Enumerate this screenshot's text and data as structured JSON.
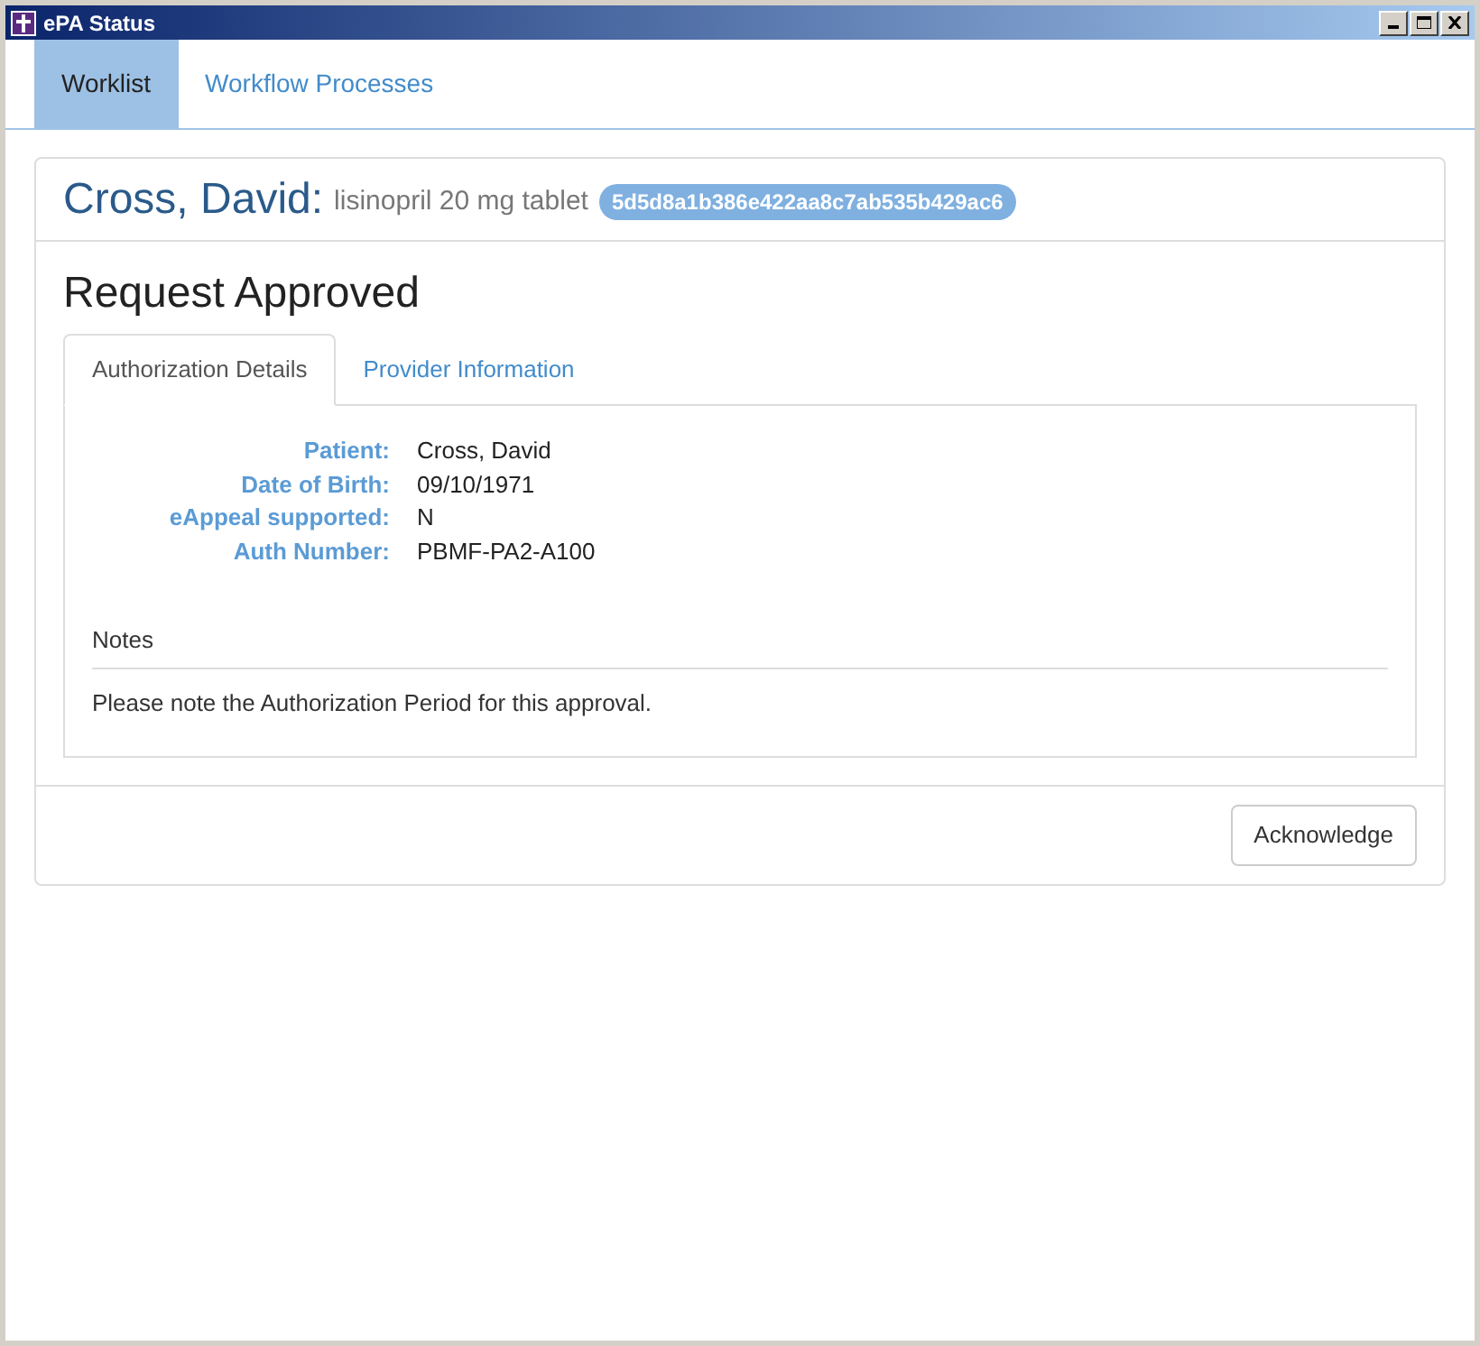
{
  "window": {
    "title": "ePA Status"
  },
  "nav_tabs": [
    {
      "label": "Worklist",
      "selected": true
    },
    {
      "label": "Workflow Processes",
      "selected": false
    }
  ],
  "header": {
    "patient_name": "Cross, David:",
    "drug": "lisinopril 20 mg tablet",
    "badge": "5d5d8a1b386e422aa8c7ab535b429ac6"
  },
  "status_title": "Request Approved",
  "detail_tabs": [
    {
      "label": "Authorization Details",
      "selected": true
    },
    {
      "label": "Provider Information",
      "selected": false
    }
  ],
  "fields": [
    {
      "label": "Patient:",
      "value": "Cross, David"
    },
    {
      "label": "Date of Birth:",
      "value": "09/10/1971"
    },
    {
      "label": "eAppeal supported:",
      "value": "N"
    },
    {
      "label": "Auth Number:",
      "value": "PBMF-PA2-A100"
    }
  ],
  "notes": {
    "heading": "Notes",
    "text": "Please note the Authorization Period for this approval."
  },
  "buttons": [
    "Acknowledge"
  ]
}
